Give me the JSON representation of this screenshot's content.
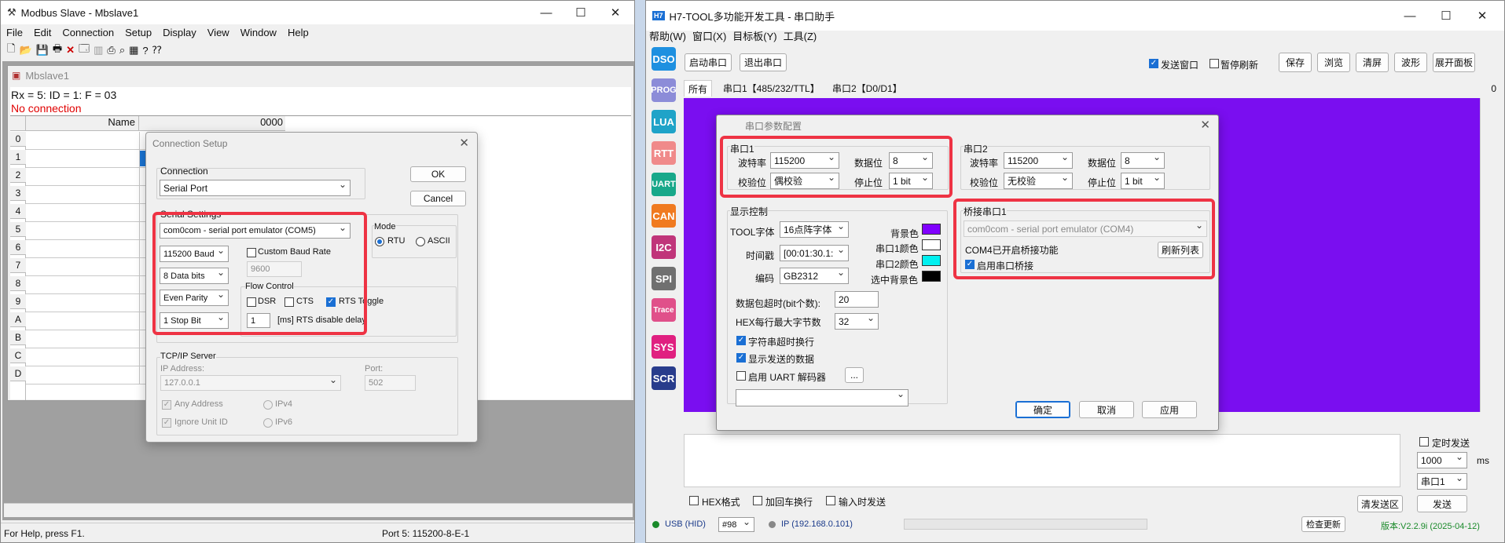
{
  "modbus": {
    "title": "Modbus Slave - Mbslave1",
    "menu": [
      "File",
      "Edit",
      "Connection",
      "Setup",
      "Display",
      "View",
      "Window",
      "Help"
    ],
    "child_title": "Mbslave1",
    "status_line": "Rx = 5: ID = 1: F = 03",
    "conn_status": "No connection",
    "col_name": "Name",
    "col_value": "0000",
    "rows": [
      "0",
      "1",
      "2",
      "3",
      "4",
      "5",
      "6",
      "7",
      "8",
      "9",
      "A",
      "B",
      "C",
      "D"
    ],
    "statusbar_left": "For Help, press F1.",
    "statusbar_right": "Port 5: 115200-8-E-1"
  },
  "conn_dialog": {
    "title": "Connection Setup",
    "connection_label": "Connection",
    "connection_value": "Serial Port",
    "ok": "OK",
    "cancel": "Cancel",
    "serial_settings": "Serial Settings",
    "port": "com0com - serial port emulator (COM5)",
    "baud": "115200 Baud",
    "databits": "8 Data bits",
    "parity": "Even Parity",
    "stopbits": "1 Stop Bit",
    "custom_baud": "Custom Baud Rate",
    "custom_baud_value": "9600",
    "mode_label": "Mode",
    "mode_rtu": "RTU",
    "mode_ascii": "ASCII",
    "flow_control": "Flow Control",
    "dsr": "DSR",
    "cts": "CTS",
    "rts_toggle": "RTS Toggle",
    "rts_delay_value": "1",
    "rts_delay_label": "[ms] RTS disable delay",
    "tcpip": "TCP/IP Server",
    "ip_label": "IP Address:",
    "ip_value": "127.0.0.1",
    "port_label": "Port:",
    "port_value": "502",
    "any_address": "Any Address",
    "ipv4": "IPv4",
    "ignore_unit": "Ignore Unit ID",
    "ipv6": "IPv6"
  },
  "h7": {
    "title": "H7-TOOL多功能开发工具 - 串口助手",
    "logo": "H7",
    "menu": [
      "帮助(W)",
      "窗口(X)",
      "目标板(Y)",
      "工具(Z)"
    ],
    "sidebar": [
      {
        "label": "DSO",
        "color": "#1e90e0"
      },
      {
        "label": "PROG",
        "color": "#8c8cd8"
      },
      {
        "label": "LUA",
        "color": "#1fa3c8"
      },
      {
        "label": "RTT",
        "color": "#f08a8a"
      },
      {
        "label": "UART",
        "color": "#18a88a"
      },
      {
        "label": "CAN",
        "color": "#f07a20"
      },
      {
        "label": "I2C",
        "color": "#c0357a"
      },
      {
        "label": "SPI",
        "color": "#707070"
      },
      {
        "label": "Trace",
        "color": "#e0508a"
      },
      {
        "label": "SYS",
        "color": "#e02080"
      },
      {
        "label": "SCR",
        "color": "#283c8c"
      }
    ],
    "btn_open": "启动串口",
    "btn_close": "退出串口",
    "send_window": "发送窗口",
    "pause_refresh": "暂停刷新",
    "btn_save": "保存",
    "btn_browse": "浏览",
    "btn_clear": "清屏",
    "btn_wave": "波形",
    "btn_expand": "展开面板",
    "tabs": [
      "所有",
      "串口1【485/232/TTL】",
      "串口2【D0/D1】"
    ],
    "count": "0",
    "hex_format": "HEX格式",
    "add_cr": "加回车换行",
    "input_send": "输入时发送",
    "timed_send": "定时发送",
    "interval": "1000",
    "ms": "ms",
    "port_select": "串口1",
    "btn_clear_send": "清发送区",
    "btn_send": "发送",
    "usb": "USB (HID)",
    "device": "#98",
    "ip": "IP (192.168.0.101)",
    "check_update": "检查更新",
    "version": "版本:V2.2.9i (2025-04-12)",
    "colors": {
      "display_bg": "#7a0ef0",
      "status_green": "#1a8a2a"
    }
  },
  "serial_dialog": {
    "title": "串口参数配置",
    "port1": "串口1",
    "port2": "串口2",
    "baud_label": "波特率",
    "databits_label": "数据位",
    "parity_label": "校验位",
    "stop_label": "停止位",
    "p1_baud": "115200",
    "p1_databits": "8",
    "p1_parity": "偶校验",
    "p1_stop": "1 bit",
    "p2_baud": "115200",
    "p2_databits": "8",
    "p2_parity": "无校验",
    "p2_stop": "1 bit",
    "display_ctrl": "显示控制",
    "tool_font_label": "TOOL字体",
    "tool_font": "16点阵字体",
    "timestamp_label": "时间戳",
    "timestamp": "[00:01:30.1:",
    "encoding_label": "编码",
    "encoding": "GB2312",
    "bg_color": "背景色",
    "p1_color": "串口1颜色",
    "p2_color": "串口2颜色",
    "sel_bg_color": "选中背景色",
    "timeout_label": "数据包超时(bit个数):",
    "timeout": "20",
    "hex_bytes_label": "HEX每行最大字节数",
    "hex_bytes": "32",
    "char_timeout_wrap": "字符串超时换行",
    "show_sent": "显示发送的数据",
    "uart_decoder": "启用 UART 解码器",
    "ellipsis": "...",
    "bridge": "桥接串口1",
    "bridge_port": "com0com - serial port emulator (COM4)",
    "bridge_status": "COM4已开启桥接功能",
    "refresh_list": "刷新列表",
    "enable_bridge": "启用串口桥接",
    "btn_ok": "确定",
    "btn_cancel": "取消",
    "btn_apply": "应用",
    "colors": {
      "bg": "#8000ff",
      "port1": "#ffffff",
      "port2": "#00f0f0",
      "sel_bg": "#000000"
    }
  }
}
